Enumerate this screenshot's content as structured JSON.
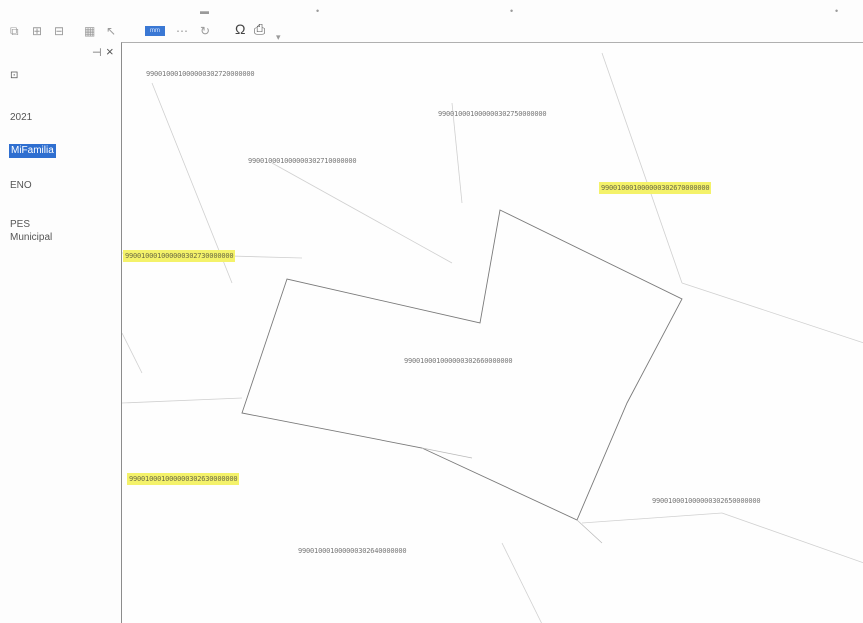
{
  "toolbar": {
    "highlighted_label": "mm",
    "icons": [
      "layout-icon",
      "grid-icon",
      "table-icon",
      "select-icon",
      "attribute-icon",
      "print-icon"
    ]
  },
  "sidebar": {
    "items": [
      {
        "label": "2021"
      },
      {
        "label": "MiFamilia",
        "selected": true
      },
      {
        "label": "ENO"
      },
      {
        "label": "PES"
      },
      {
        "label": "Municipal"
      }
    ]
  },
  "map": {
    "labels": [
      "990010001000000302720000000",
      "990010001000000302750000000",
      "990010001000000302710000000",
      "990010001000000302670000000",
      "990010001000000302730000000",
      "990010001000000302660000000",
      "990010001000000302630000000",
      "990010001000000302650000000",
      "990010001000000302640000000"
    ]
  },
  "colors": {
    "highlight": "#f4f26a",
    "selected": "#2f6fd0"
  }
}
